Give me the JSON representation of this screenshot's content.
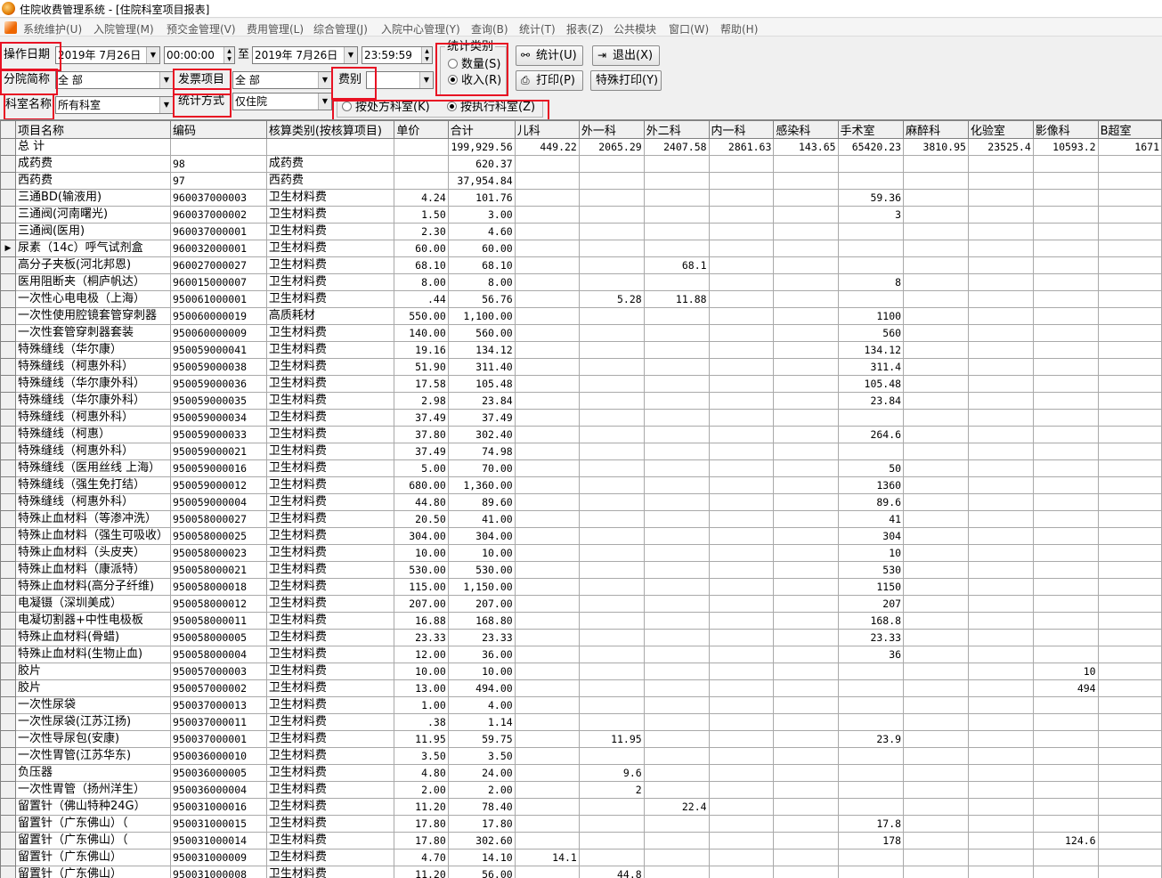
{
  "window": {
    "title": "住院收费管理系统 - [住院科室项目报表]"
  },
  "menu": [
    "系统维护(U)",
    "入院管理(M)",
    "预交金管理(V)",
    "费用管理(L)",
    "综合管理(J)",
    "入院中心管理(Y)",
    "查询(B)",
    "统计(T)",
    "报表(Z)",
    "公共模块",
    "窗口(W)",
    "帮助(H)"
  ],
  "filters": {
    "date_label": "操作日期",
    "start_date": "2019年 7月26日",
    "start_time": "00:00:00",
    "to_label": "至",
    "end_date": "2019年 7月26日",
    "end_time": "23:59:59",
    "branch_label": "分院简称",
    "branch_value": "全 部",
    "invoice_label": "发票项目",
    "invoice_value": "全 部",
    "fee_label": "费别",
    "fee_value": "",
    "dept_label": "科室名称",
    "dept_value": "所有科室",
    "method_label": "统计方式",
    "method_value": "仅住院",
    "stat_type_title": "统计类别",
    "stat_type_options": [
      "数量(S)",
      "收入(R)"
    ],
    "stat_type_selected": "收入(R)",
    "dept_basis_options": [
      "按处方科室(K)",
      "按执行科室(Z)"
    ],
    "dept_basis_selected": "按执行科室(Z)"
  },
  "buttons": {
    "stats": "统计(U)",
    "exit": "退出(X)",
    "print": "打印(P)",
    "special_print": "特殊打印(Y)"
  },
  "table": {
    "columns": [
      "项目名称",
      "编码",
      "核算类别(按核算项目)",
      "单价",
      "合计",
      "儿科",
      "外一科",
      "外二科",
      "内一科",
      "感染科",
      "手术室",
      "麻醉科",
      "化验室",
      "影像科",
      "B超室"
    ],
    "current_row_marker": "▶",
    "rows": [
      [
        "总 计",
        "",
        "",
        "",
        "199,929.56",
        "449.22",
        "2065.29",
        "2407.58",
        "2861.63",
        "143.65",
        "65420.23",
        "3810.95",
        "23525.4",
        "10593.2",
        "1671"
      ],
      [
        "成药费",
        "98",
        "成药费",
        "",
        "620.37",
        "",
        "",
        "",
        "",
        "",
        "",
        "",
        "",
        "",
        ""
      ],
      [
        "西药费",
        "97",
        "西药费",
        "",
        "37,954.84",
        "",
        "",
        "",
        "",
        "",
        "",
        "",
        "",
        "",
        ""
      ],
      [
        "三通BD(输液用)",
        "960037000003",
        "卫生材料费",
        "4.24",
        "101.76",
        "",
        "",
        "",
        "",
        "",
        "59.36",
        "",
        "",
        "",
        ""
      ],
      [
        "三通阀(河南曙光)",
        "960037000002",
        "卫生材料费",
        "1.50",
        "3.00",
        "",
        "",
        "",
        "",
        "",
        "3",
        "",
        "",
        "",
        ""
      ],
      [
        "三通阀(医用)",
        "960037000001",
        "卫生材料费",
        "2.30",
        "4.60",
        "",
        "",
        "",
        "",
        "",
        "",
        "",
        "",
        "",
        ""
      ],
      [
        "尿素（14c）呼气试剂盒",
        "960032000001",
        "卫生材料费",
        "60.00",
        "60.00",
        "",
        "",
        "",
        "",
        "",
        "",
        "",
        "",
        "",
        ""
      ],
      [
        "高分子夹板(河北邦恩)",
        "960027000027",
        "卫生材料费",
        "68.10",
        "68.10",
        "",
        "",
        "68.1",
        "",
        "",
        "",
        "",
        "",
        "",
        ""
      ],
      [
        "医用阻断夹（桐庐帆达）",
        "960015000007",
        "卫生材料费",
        "8.00",
        "8.00",
        "",
        "",
        "",
        "",
        "",
        "8",
        "",
        "",
        "",
        ""
      ],
      [
        "一次性心电电极（上海）",
        "950061000001",
        "卫生材料费",
        ".44",
        "56.76",
        "",
        "5.28",
        "11.88",
        "",
        "",
        "",
        "",
        "",
        "",
        ""
      ],
      [
        "一次性使用腔镜套管穿刺器",
        "950060000019",
        "高质耗材",
        "550.00",
        "1,100.00",
        "",
        "",
        "",
        "",
        "",
        "1100",
        "",
        "",
        "",
        ""
      ],
      [
        "一次性套管穿刺器套装",
        "950060000009",
        "卫生材料费",
        "140.00",
        "560.00",
        "",
        "",
        "",
        "",
        "",
        "560",
        "",
        "",
        "",
        ""
      ],
      [
        "特殊缝线（华尔康）",
        "950059000041",
        "卫生材料费",
        "19.16",
        "134.12",
        "",
        "",
        "",
        "",
        "",
        "134.12",
        "",
        "",
        "",
        ""
      ],
      [
        "特殊缝线（柯惠外科）",
        "950059000038",
        "卫生材料费",
        "51.90",
        "311.40",
        "",
        "",
        "",
        "",
        "",
        "311.4",
        "",
        "",
        "",
        ""
      ],
      [
        "特殊缝线（华尔康外科）",
        "950059000036",
        "卫生材料费",
        "17.58",
        "105.48",
        "",
        "",
        "",
        "",
        "",
        "105.48",
        "",
        "",
        "",
        ""
      ],
      [
        "特殊缝线（华尔康外科）",
        "950059000035",
        "卫生材料费",
        "2.98",
        "23.84",
        "",
        "",
        "",
        "",
        "",
        "23.84",
        "",
        "",
        "",
        ""
      ],
      [
        "特殊缝线（柯惠外科）",
        "950059000034",
        "卫生材料费",
        "37.49",
        "37.49",
        "",
        "",
        "",
        "",
        "",
        "",
        "",
        "",
        "",
        ""
      ],
      [
        "特殊缝线（柯惠）",
        "950059000033",
        "卫生材料费",
        "37.80",
        "302.40",
        "",
        "",
        "",
        "",
        "",
        "264.6",
        "",
        "",
        "",
        ""
      ],
      [
        "特殊缝线（柯惠外科）",
        "950059000021",
        "卫生材料费",
        "37.49",
        "74.98",
        "",
        "",
        "",
        "",
        "",
        "",
        "",
        "",
        "",
        ""
      ],
      [
        "特殊缝线（医用丝线 上海）",
        "950059000016",
        "卫生材料费",
        "5.00",
        "70.00",
        "",
        "",
        "",
        "",
        "",
        "50",
        "",
        "",
        "",
        ""
      ],
      [
        "特殊缝线（强生免打结）",
        "950059000012",
        "卫生材料费",
        "680.00",
        "1,360.00",
        "",
        "",
        "",
        "",
        "",
        "1360",
        "",
        "",
        "",
        ""
      ],
      [
        "特殊缝线（柯惠外科）",
        "950059000004",
        "卫生材料费",
        "44.80",
        "89.60",
        "",
        "",
        "",
        "",
        "",
        "89.6",
        "",
        "",
        "",
        ""
      ],
      [
        "特殊止血材料（等渗冲洗）",
        "950058000027",
        "卫生材料费",
        "20.50",
        "41.00",
        "",
        "",
        "",
        "",
        "",
        "41",
        "",
        "",
        "",
        ""
      ],
      [
        "特殊止血材料（强生可吸收）",
        "950058000025",
        "卫生材料费",
        "304.00",
        "304.00",
        "",
        "",
        "",
        "",
        "",
        "304",
        "",
        "",
        "",
        ""
      ],
      [
        "特殊止血材料（头皮夹）",
        "950058000023",
        "卫生材料费",
        "10.00",
        "10.00",
        "",
        "",
        "",
        "",
        "",
        "10",
        "",
        "",
        "",
        ""
      ],
      [
        "特殊止血材料（康派特）",
        "950058000021",
        "卫生材料费",
        "530.00",
        "530.00",
        "",
        "",
        "",
        "",
        "",
        "530",
        "",
        "",
        "",
        ""
      ],
      [
        "特殊止血材料(高分子纤维)",
        "950058000018",
        "卫生材料费",
        "115.00",
        "1,150.00",
        "",
        "",
        "",
        "",
        "",
        "1150",
        "",
        "",
        "",
        ""
      ],
      [
        "电凝镊（深圳美成）",
        "950058000012",
        "卫生材料费",
        "207.00",
        "207.00",
        "",
        "",
        "",
        "",
        "",
        "207",
        "",
        "",
        "",
        ""
      ],
      [
        "电凝切割器+中性电极板",
        "950058000011",
        "卫生材料费",
        "16.88",
        "168.80",
        "",
        "",
        "",
        "",
        "",
        "168.8",
        "",
        "",
        "",
        ""
      ],
      [
        "特殊止血材料(骨蜡)",
        "950058000005",
        "卫生材料费",
        "23.33",
        "23.33",
        "",
        "",
        "",
        "",
        "",
        "23.33",
        "",
        "",
        "",
        ""
      ],
      [
        "特殊止血材料(生物止血)",
        "950058000004",
        "卫生材料费",
        "12.00",
        "36.00",
        "",
        "",
        "",
        "",
        "",
        "36",
        "",
        "",
        "",
        ""
      ],
      [
        "胶片",
        "950057000003",
        "卫生材料费",
        "10.00",
        "10.00",
        "",
        "",
        "",
        "",
        "",
        "",
        "",
        "",
        "10",
        ""
      ],
      [
        "胶片",
        "950057000002",
        "卫生材料费",
        "13.00",
        "494.00",
        "",
        "",
        "",
        "",
        "",
        "",
        "",
        "",
        "494",
        ""
      ],
      [
        "一次性尿袋",
        "950037000013",
        "卫生材料费",
        "1.00",
        "4.00",
        "",
        "",
        "",
        "",
        "",
        "",
        "",
        "",
        "",
        ""
      ],
      [
        "一次性尿袋(江苏江扬)",
        "950037000011",
        "卫生材料费",
        ".38",
        "1.14",
        "",
        "",
        "",
        "",
        "",
        "",
        "",
        "",
        "",
        ""
      ],
      [
        "一次性导尿包(安康)",
        "950037000001",
        "卫生材料费",
        "11.95",
        "59.75",
        "",
        "11.95",
        "",
        "",
        "",
        "23.9",
        "",
        "",
        "",
        ""
      ],
      [
        "一次性胃管(江苏华东)",
        "950036000010",
        "卫生材料费",
        "3.50",
        "3.50",
        "",
        "",
        "",
        "",
        "",
        "",
        "",
        "",
        "",
        ""
      ],
      [
        "负压器",
        "950036000005",
        "卫生材料费",
        "4.80",
        "24.00",
        "",
        "9.6",
        "",
        "",
        "",
        "",
        "",
        "",
        "",
        ""
      ],
      [
        "一次性胃管（扬州洋生）",
        "950036000004",
        "卫生材料费",
        "2.00",
        "2.00",
        "",
        "2",
        "",
        "",
        "",
        "",
        "",
        "",
        "",
        ""
      ],
      [
        "留置针（佛山特种24G）",
        "950031000016",
        "卫生材料费",
        "11.20",
        "78.40",
        "",
        "",
        "22.4",
        "",
        "",
        "",
        "",
        "",
        "",
        ""
      ],
      [
        "留置针（广东佛山）（",
        "950031000015",
        "卫生材料费",
        "17.80",
        "17.80",
        "",
        "",
        "",
        "",
        "",
        "17.8",
        "",
        "",
        "",
        ""
      ],
      [
        "留置针（广东佛山）（",
        "950031000014",
        "卫生材料费",
        "17.80",
        "302.60",
        "",
        "",
        "",
        "",
        "",
        "178",
        "",
        "",
        "124.6",
        ""
      ],
      [
        "留置针（广东佛山）",
        "950031000009",
        "卫生材料费",
        "4.70",
        "14.10",
        "14.1",
        "",
        "",
        "",
        "",
        "",
        "",
        "",
        "",
        ""
      ],
      [
        "留置针（广东佛山）",
        "950031000008",
        "卫生材料费",
        "11.20",
        "56.00",
        "",
        "44.8",
        "",
        "",
        "",
        "",
        "",
        "",
        "",
        ""
      ]
    ]
  },
  "icons": {
    "app": "hospital-logo-icon",
    "stats": "binoculars-icon",
    "exit": "exit-door-icon",
    "print": "printer-icon"
  },
  "colors": {
    "highlight_box": "#e81123",
    "background": "#f0f0f0"
  }
}
